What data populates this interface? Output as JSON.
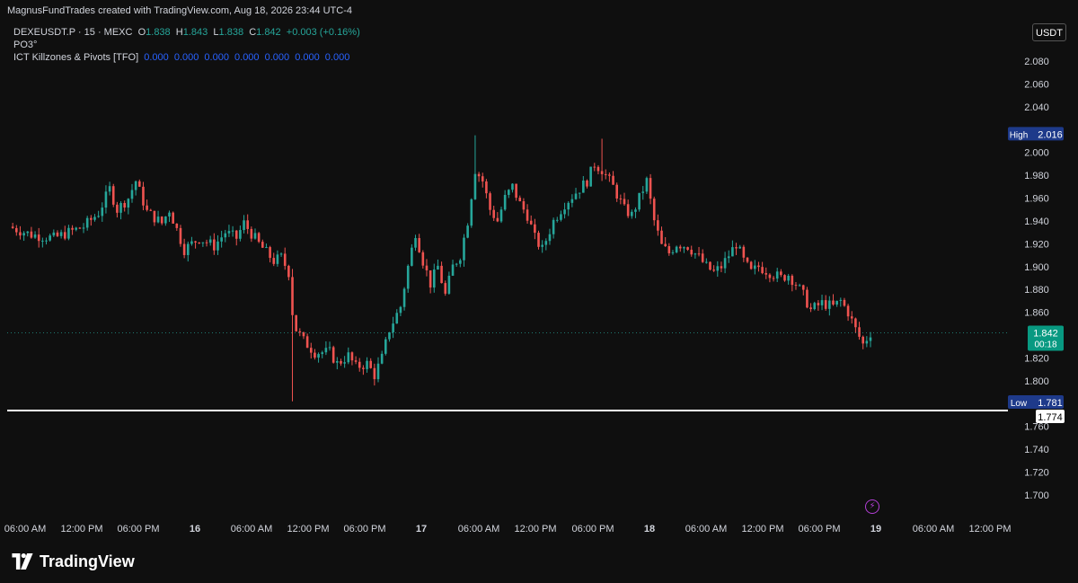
{
  "header": {
    "title": "MagnusFundTrades created with TradingView.com, Aug 18, 2026 23:44 UTC-4"
  },
  "legend": {
    "symbol": "DEXEUSDT.P · 15 · MEXC",
    "o_label": "O",
    "o_value": "1.838",
    "h_label": "H",
    "h_value": "1.843",
    "l_label": "L",
    "l_value": "1.838",
    "c_label": "C",
    "c_value": "1.842",
    "change": "+0.003 (+0.16%)",
    "indicator1": "PO3°",
    "indicator2_name": "ICT Killzones & Pivots [TFO]",
    "indicator2_values": [
      "0.000",
      "0.000",
      "0.000",
      "0.000",
      "0.000",
      "0.000",
      "0.000"
    ]
  },
  "currency": "USDT",
  "colors": {
    "up": "#26a69a",
    "down": "#ef5350",
    "background": "#0f0f0f",
    "axis_text": "#d1d4dc",
    "high_low_label_bg": "#1e3a8a",
    "last_price_bg": "#089981"
  },
  "chart_data": {
    "type": "candlestick",
    "symbol": "DEXEUSDT.P",
    "interval": "15",
    "exchange": "MEXC",
    "ylim": [
      1.69,
      2.09
    ],
    "y_ticks": [
      "2.080",
      "2.060",
      "2.040",
      "2.000",
      "1.980",
      "1.960",
      "1.940",
      "1.920",
      "1.900",
      "1.880",
      "1.860",
      "1.820",
      "1.800",
      "1.760",
      "1.740",
      "1.720",
      "1.700"
    ],
    "x_tick_labels": [
      "06:00 AM",
      "12:00 PM",
      "06:00 PM",
      "16",
      "06:00 AM",
      "12:00 PM",
      "06:00 PM",
      "17",
      "06:00 AM",
      "12:00 PM",
      "06:00 PM",
      "18",
      "06:00 AM",
      "12:00 PM",
      "06:00 PM",
      "19",
      "06:00 AM",
      "12:00 PM"
    ],
    "bold_x_ticks": [
      "16",
      "17",
      "18",
      "19"
    ],
    "price_path": [
      [
        0,
        1.935
      ],
      [
        6,
        1.928
      ],
      [
        12,
        1.925
      ],
      [
        16,
        1.93
      ],
      [
        20,
        1.935
      ],
      [
        24,
        1.947
      ],
      [
        27,
        1.968
      ],
      [
        29,
        1.95
      ],
      [
        32,
        1.96
      ],
      [
        34,
        1.975
      ],
      [
        37,
        1.948
      ],
      [
        41,
        1.938
      ],
      [
        43,
        1.95
      ],
      [
        47,
        1.915
      ],
      [
        51,
        1.925
      ],
      [
        55,
        1.918
      ],
      [
        58,
        1.93
      ],
      [
        61,
        1.925
      ],
      [
        63,
        1.938
      ],
      [
        67,
        1.92
      ],
      [
        71,
        1.905
      ],
      [
        73,
        1.908
      ],
      [
        75,
        1.895
      ],
      [
        76,
        1.86
      ],
      [
        77,
        1.845
      ],
      [
        79,
        1.835
      ],
      [
        82,
        1.825
      ],
      [
        86,
        1.825
      ],
      [
        88,
        1.815
      ],
      [
        91,
        1.822
      ],
      [
        93,
        1.812
      ],
      [
        96,
        1.815
      ],
      [
        98,
        1.805
      ],
      [
        100,
        1.82
      ],
      [
        102,
        1.845
      ],
      [
        105,
        1.865
      ],
      [
        107,
        1.9
      ],
      [
        109,
        1.93
      ],
      [
        111,
        1.905
      ],
      [
        113,
        1.885
      ],
      [
        115,
        1.9
      ],
      [
        117,
        1.875
      ],
      [
        119,
        1.9
      ],
      [
        121,
        1.91
      ],
      [
        123,
        1.94
      ],
      [
        125,
        1.985
      ],
      [
        127,
        1.975
      ],
      [
        129,
        1.95
      ],
      [
        131,
        1.94
      ],
      [
        133,
        1.96
      ],
      [
        135,
        1.97
      ],
      [
        137,
        1.955
      ],
      [
        139,
        1.945
      ],
      [
        141,
        1.925
      ],
      [
        143,
        1.915
      ],
      [
        146,
        1.94
      ],
      [
        149,
        1.955
      ],
      [
        152,
        1.965
      ],
      [
        155,
        1.975
      ],
      [
        157,
        1.99
      ],
      [
        159,
        1.985
      ],
      [
        162,
        1.97
      ],
      [
        165,
        1.95
      ],
      [
        167,
        1.945
      ],
      [
        169,
        1.96
      ],
      [
        171,
        1.975
      ],
      [
        173,
        1.94
      ],
      [
        175,
        1.918
      ],
      [
        177,
        1.912
      ],
      [
        179,
        1.92
      ],
      [
        182,
        1.918
      ],
      [
        185,
        1.908
      ],
      [
        187,
        1.9
      ],
      [
        189,
        1.895
      ],
      [
        191,
        1.9
      ],
      [
        193,
        1.91
      ],
      [
        195,
        1.92
      ],
      [
        197,
        1.905
      ],
      [
        199,
        1.895
      ],
      [
        201,
        1.9
      ],
      [
        204,
        1.895
      ],
      [
        207,
        1.89
      ],
      [
        209,
        1.893
      ],
      [
        211,
        1.885
      ],
      [
        213,
        1.875
      ],
      [
        215,
        1.862
      ],
      [
        218,
        1.868
      ],
      [
        221,
        1.865
      ],
      [
        223,
        1.87
      ],
      [
        225,
        1.86
      ],
      [
        227,
        1.845
      ],
      [
        229,
        1.832
      ],
      [
        231,
        1.842
      ]
    ],
    "wicks": [
      {
        "index": 76,
        "high": 1.898,
        "low": 1.782
      },
      {
        "index": 125,
        "high": 2.015,
        "low": 1.96
      },
      {
        "index": 159,
        "high": 2.012,
        "low": 1.975
      },
      {
        "index": 98,
        "high": 1.815,
        "low": 1.798
      }
    ],
    "last_price": "1.842",
    "countdown": "00:18",
    "high_label": "High",
    "high_value": "2.016",
    "low_label": "Low",
    "low_value": "1.781",
    "hline_value": "1.774",
    "hline": 1.774
  },
  "footer": {
    "brand": "TradingView"
  }
}
